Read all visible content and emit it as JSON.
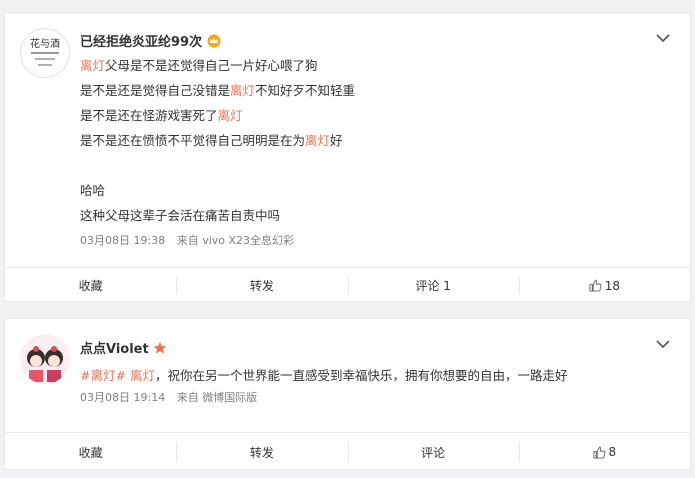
{
  "posts": [
    {
      "avatar": "花与酒",
      "username": "已经拒绝炎亚纶99次",
      "badge_icon": "crown-icon",
      "lines": [
        [
          {
            "t": "离灯",
            "hl": true
          },
          {
            "t": "父母是不是还觉得自己一片好心喂了狗"
          }
        ],
        [
          {
            "t": "是不是还是觉得自己没错是"
          },
          {
            "t": "离灯",
            "hl": true
          },
          {
            "t": "不知好歹不知轻重"
          }
        ],
        [
          {
            "t": "是不是还在怪游戏害死了"
          },
          {
            "t": "离灯",
            "hl": true
          }
        ],
        [
          {
            "t": "是不是还在愤愤不平觉得自己明明是在为"
          },
          {
            "t": "离灯",
            "hl": true
          },
          {
            "t": "好"
          }
        ],
        [],
        [
          {
            "t": "哈哈"
          }
        ],
        [
          {
            "t": "这种父母这辈子会活在痛苦自责中吗"
          }
        ]
      ],
      "time": "03月08日 19:38",
      "source": "来自 vivo X23全息幻彩",
      "actions": {
        "favorite": "收藏",
        "repost": "转发",
        "comment": "评论 1",
        "like_count": "18"
      }
    },
    {
      "username": "点点Violet",
      "badge_icon": "star-icon",
      "lines": [
        [
          {
            "t": "#离灯#",
            "hl": true
          },
          {
            "t": " "
          },
          {
            "t": "离灯",
            "hl": true
          },
          {
            "t": "，祝你在另一个世界能一直感受到幸福快乐，拥有你想要的自由，一路走好"
          }
        ]
      ],
      "time": "03月08日 19:14",
      "source": "来自 微博国际版",
      "actions": {
        "favorite": "收藏",
        "repost": "转发",
        "comment": "评论",
        "like_count": "8"
      }
    }
  ],
  "colors": {
    "highlight": "#eb7350",
    "badge_star": "#eb7350",
    "badge_crown": "#f5a623"
  }
}
